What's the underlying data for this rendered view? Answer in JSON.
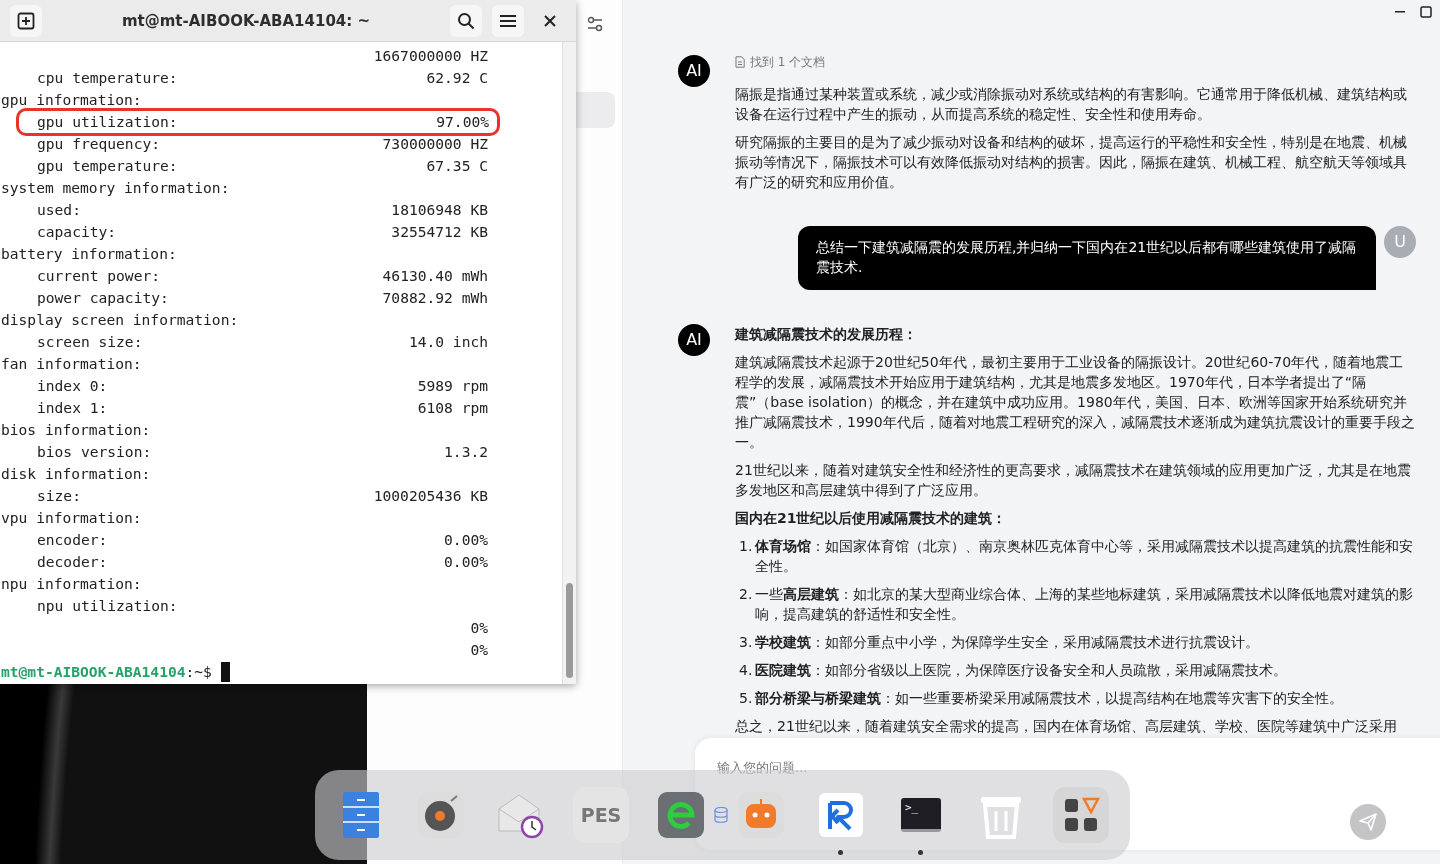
{
  "terminal": {
    "title": "mt@mt-AIBOOK-ABA14104: ~",
    "sections": [
      {
        "children": [
          {
            "value": "1667000000 HZ",
            "circled": false
          },
          {
            "label": "cpu temperature:",
            "value": "62.92 C",
            "circled": false
          }
        ]
      },
      {
        "heading": "gpu information:",
        "children": [
          {
            "label": "gpu utilization:",
            "value": "97.00%",
            "circled": true
          },
          {
            "label": "gpu frequency:",
            "value": "730000000 HZ",
            "circled": false
          },
          {
            "label": "gpu temperature:",
            "value": "67.35 C",
            "circled": false
          }
        ]
      },
      {
        "heading": "system memory information:",
        "children": [
          {
            "label": "used:",
            "value": "18106948 KB",
            "circled": false
          },
          {
            "label": "capacity:",
            "value": "32554712 KB",
            "circled": false
          }
        ]
      },
      {
        "heading": "battery information:",
        "children": [
          {
            "label": "current power:",
            "value": "46130.40 mWh",
            "circled": false
          },
          {
            "label": "power capacity:",
            "value": "70882.92 mWh",
            "circled": false
          }
        ]
      },
      {
        "heading": "display screen information:",
        "children": [
          {
            "label": "screen size:",
            "value": "14.0 inch",
            "circled": false
          }
        ]
      },
      {
        "heading": "fan information:",
        "children": [
          {
            "label": "index 0:",
            "value": "5989 rpm",
            "circled": false
          },
          {
            "label": "index 1:",
            "value": "6108 rpm",
            "circled": false
          }
        ]
      },
      {
        "heading": "bios information:",
        "children": [
          {
            "label": "bios version:",
            "value": "1.3.2",
            "circled": false
          }
        ]
      },
      {
        "heading": "disk information:",
        "children": [
          {
            "label": "size:",
            "value": "1000205436 KB",
            "circled": false
          }
        ]
      },
      {
        "heading": "vpu information:",
        "children": [
          {
            "label": "encoder:",
            "value": "0.00%",
            "circled": false
          },
          {
            "label": "decoder:",
            "value": "0.00%",
            "circled": false
          }
        ]
      },
      {
        "heading": "npu information:",
        "children": [
          {
            "label": "npu utilization:",
            "circled": false
          },
          {
            "value": "0%",
            "circled": false
          },
          {
            "value": "0%",
            "circled": false
          }
        ]
      }
    ],
    "prompt": {
      "user_host": "mt@mt-AIBOOK-ABA14104",
      "path": ":~$"
    }
  },
  "chat": {
    "messages": [
      {
        "kind": "ai",
        "avatar": "AI",
        "source": "找到 1 个文档",
        "blocks": [
          {
            "kind": "paragraph",
            "text": "隔振是指通过某种装置或系统，减少或消除振动对系统或结构的有害影响。它通常用于降低机械、建筑结构或设备在运行过程中产生的振动，从而提高系统的稳定性、安全性和使用寿命。"
          },
          {
            "kind": "paragraph",
            "text": "研究隔振的主要目的是为了减少振动对设备和结构的破坏，提高运行的平稳性和安全性，特别是在地震、机械振动等情况下，隔振技术可以有效降低振动对结构的损害。因此，隔振在建筑、机械工程、航空航天等领域具有广泛的研究和应用价值。"
          }
        ]
      },
      {
        "kind": "user",
        "avatar": "U",
        "text": "总结一下建筑减隔震的发展历程,并归纳一下国内在21世纪以后都有哪些建筑使用了减隔震技术."
      },
      {
        "kind": "ai",
        "avatar": "AI",
        "blocks": [
          {
            "kind": "heading",
            "text": "建筑减隔震技术的发展历程："
          },
          {
            "kind": "paragraph",
            "text": "建筑减隔震技术起源于20世纪50年代，最初主要用于工业设备的隔振设计。20世纪60-70年代，随着地震工程学的发展，减隔震技术开始应用于建筑结构，尤其是地震多发地区。1970年代，日本学者提出了“隔震”（base isolation）的概念，并在建筑中成功应用。1980年代，美国、日本、欧洲等国家开始系统研究并推广减隔震技术，1990年代后，随着对地震工程研究的深入，减隔震技术逐渐成为建筑抗震设计的重要手段之一。"
          },
          {
            "kind": "paragraph",
            "text": "21世纪以来，随着对建筑安全性和经济性的更高要求，减隔震技术在建筑领域的应用更加广泛，尤其是在地震多发地区和高层建筑中得到了广泛应用。"
          },
          {
            "kind": "heading",
            "text": "国内在21世纪以后使用减隔震技术的建筑："
          },
          {
            "kind": "list",
            "items": [
              {
                "number": "1.",
                "text": "**体育场馆**：如国家体育馆（北京）、南京奥林匹克体育中心等，采用减隔震技术以提高建筑的抗震性能和安全性。"
              },
              {
                "number": "2.",
                "text": "一些**高层建筑**：如北京的某大型商业综合体、上海的某些地标建筑，采用减隔震技术以降低地震对建筑的影响，提高建筑的舒适性和安全性。"
              },
              {
                "number": "3.",
                "text": "**学校建筑**：如部分重点中小学，为保障学生安全，采用减隔震技术进行抗震设计。"
              },
              {
                "number": "4.",
                "text": "**医院建筑**：如部分省级以上医院，为保障医疗设备安全和人员疏散，采用减隔震技术。"
              },
              {
                "number": "5.",
                "text": "**部分桥梁与桥梁建筑**：如一些重要桥梁采用减隔震技术，以提高结构在地震等灾害下的安全性。"
              }
            ]
          },
          {
            "kind": "paragraph",
            "text": "总之，21世纪以来，随着建筑安全需求的提高，国内在体育场馆、高层建筑、学校、医院等建筑中广泛采用"
          }
        ]
      }
    ],
    "input": {
      "placeholder": "输入您的问题..."
    }
  },
  "dock": {
    "items": [
      {
        "kind": "files",
        "running": false
      },
      {
        "kind": "music",
        "running": false
      },
      {
        "kind": "mail-clock",
        "running": false
      },
      {
        "kind": "pes",
        "label": "PES",
        "running": false
      },
      {
        "kind": "browser",
        "running": false
      },
      {
        "kind": "database",
        "running": false
      },
      {
        "kind": "robot",
        "running": false
      },
      {
        "kind": "r-app",
        "running": true
      },
      {
        "kind": "terminal",
        "label": ">_",
        "running": true
      },
      {
        "kind": "trash",
        "running": false
      },
      {
        "kind": "apps",
        "running": false
      }
    ]
  }
}
